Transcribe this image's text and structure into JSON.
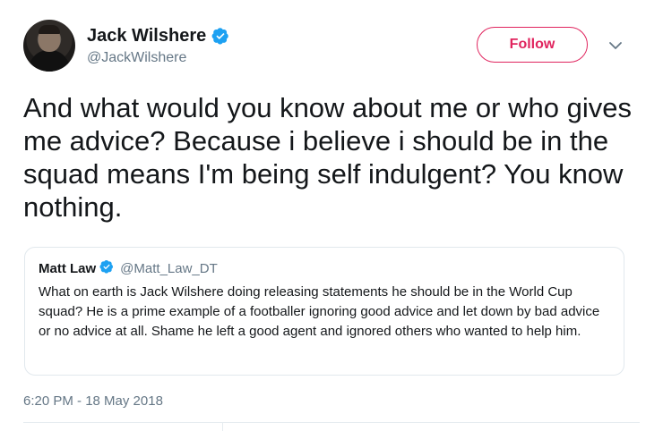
{
  "author": {
    "name": "Jack Wilshere",
    "handle": "@JackWilshere",
    "verified": true
  },
  "follow_label": "Follow",
  "tweet_text": "And what would you know about me or who gives me advice? Because i believe i should be in the squad means I'm being self indulgent? You know nothing.",
  "quoted_tweet": {
    "name": "Matt Law",
    "handle": "@Matt_Law_DT",
    "verified": true,
    "text": "What on earth is Jack Wilshere doing releasing statements he should be in the World Cup squad? He is a prime example of a footballer ignoring good advice and let down by bad advice or no advice at all. Shame he left a good agent and ignored others who wanted to help him."
  },
  "timestamp": "6:20 PM - 18 May 2018",
  "colors": {
    "accent": "#e0245e",
    "verified_blue": "#1da1f2",
    "secondary_text": "#657786",
    "border": "#e1e8ed"
  },
  "icons": {
    "verified": "verified-badge-icon",
    "caret": "chevron-down-icon"
  }
}
